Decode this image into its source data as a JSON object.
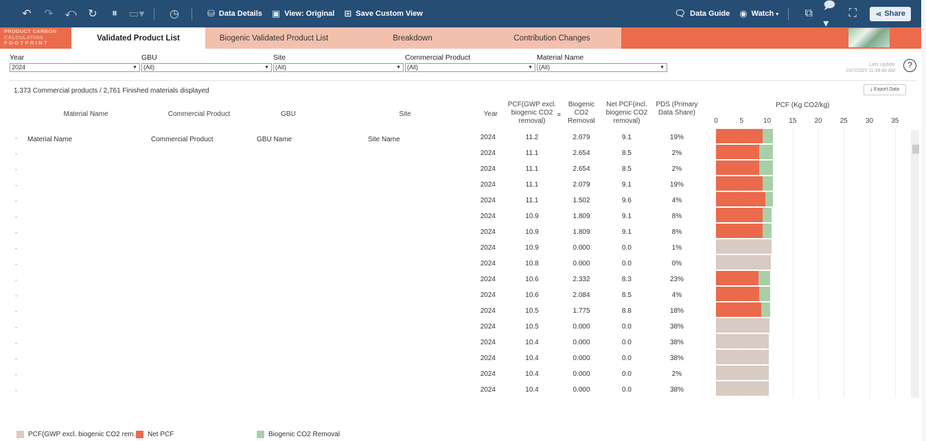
{
  "toolbar": {
    "icons": [
      "undo-icon",
      "redo-icon",
      "revert-icon",
      "refresh-icon",
      "pause-icon",
      "present-icon",
      "history-icon"
    ],
    "data_details": "Data Details",
    "view_original": "View: Original",
    "save_custom_view": "Save Custom View",
    "data_guide": "Data Guide",
    "watch": "Watch",
    "share": "Share"
  },
  "logo": {
    "line1": "PRODUCT CARBON",
    "line2": "CALCULATION",
    "line3": "FOOTPRINT"
  },
  "tabs": [
    {
      "label": "Validated Product List",
      "active": true
    },
    {
      "label": "Biogenic Validated Product List",
      "active": false
    },
    {
      "label": "Breakdown",
      "active": false
    },
    {
      "label": "Contribution Changes",
      "active": false
    }
  ],
  "filters": {
    "year": {
      "label": "Year",
      "value": "2024"
    },
    "gbu": {
      "label": "GBU",
      "value": "(All)"
    },
    "site": {
      "label": "Site",
      "value": "(All)"
    },
    "commercial_product": {
      "label": "Commercial Product",
      "value": "(All)"
    },
    "material_name": {
      "label": "Material Name",
      "value": "(All)"
    }
  },
  "last_update": {
    "label": "Last Update",
    "value": "10/7/2025 11:39:48 AM"
  },
  "summary": "1,373 Commercial products / 2,761 Finished materials displayed",
  "export_label": "Export Data",
  "columns": {
    "material_name": "Material Name",
    "commercial_product": "Commercial Product",
    "gbu": "GBU",
    "site": "Site",
    "year": "Year",
    "pcf": "PCF(GWP excl. biogenic CO2 removal)",
    "biogenic": "Biogenic CO2 Removal",
    "net_pcf": "Net PCF(incl. biogenic CO2 removal)",
    "pds": "PDS (Primary Data Share)",
    "chart": "PCF (Kg CO2/kg)"
  },
  "first_row_text": {
    "material_name": "Material Name",
    "commercial_product": "Commercial Product",
    "gbu": "GBU Name",
    "site": "Site Name"
  },
  "rows": [
    {
      "year": "2024",
      "pcf": "11.2",
      "bio": "2.079",
      "net": "9.1",
      "pds": "19%"
    },
    {
      "year": "2024",
      "pcf": "11.1",
      "bio": "2.654",
      "net": "8.5",
      "pds": "2%"
    },
    {
      "year": "2024",
      "pcf": "11.1",
      "bio": "2.654",
      "net": "8.5",
      "pds": "2%"
    },
    {
      "year": "2024",
      "pcf": "11.1",
      "bio": "2.079",
      "net": "9.1",
      "pds": "19%"
    },
    {
      "year": "2024",
      "pcf": "11.1",
      "bio": "1.502",
      "net": "9.6",
      "pds": "4%"
    },
    {
      "year": "2024",
      "pcf": "10.9",
      "bio": "1.809",
      "net": "9.1",
      "pds": "8%"
    },
    {
      "year": "2024",
      "pcf": "10.9",
      "bio": "1.809",
      "net": "9.1",
      "pds": "8%"
    },
    {
      "year": "2024",
      "pcf": "10.9",
      "bio": "0.000",
      "net": "0.0",
      "pds": "1%"
    },
    {
      "year": "2024",
      "pcf": "10.8",
      "bio": "0.000",
      "net": "0.0",
      "pds": "0%"
    },
    {
      "year": "2024",
      "pcf": "10.6",
      "bio": "2.332",
      "net": "8.3",
      "pds": "23%"
    },
    {
      "year": "2024",
      "pcf": "10.6",
      "bio": "2.084",
      "net": "8.5",
      "pds": "4%"
    },
    {
      "year": "2024",
      "pcf": "10.5",
      "bio": "1.775",
      "net": "8.8",
      "pds": "18%"
    },
    {
      "year": "2024",
      "pcf": "10.5",
      "bio": "0.000",
      "net": "0.0",
      "pds": "38%"
    },
    {
      "year": "2024",
      "pcf": "10.4",
      "bio": "0.000",
      "net": "0.0",
      "pds": "38%"
    },
    {
      "year": "2024",
      "pcf": "10.4",
      "bio": "0.000",
      "net": "0.0",
      "pds": "38%"
    },
    {
      "year": "2024",
      "pcf": "10.4",
      "bio": "0.000",
      "net": "0.0",
      "pds": "2%"
    },
    {
      "year": "2024",
      "pcf": "10.4",
      "bio": "0.000",
      "net": "0.0",
      "pds": "38%"
    }
  ],
  "chart_data": {
    "type": "bar",
    "title": "PCF (Kg CO2/kg)",
    "xlim": [
      0,
      35
    ],
    "x_ticks": [
      "0",
      "5",
      "10",
      "15",
      "20",
      "25",
      "30",
      "35"
    ],
    "series": [
      {
        "name": "PCF(GWP excl. biogenic CO2 rem...",
        "color": "#d7cbc3",
        "values": [
          11.2,
          11.1,
          11.1,
          11.1,
          11.1,
          10.9,
          10.9,
          10.9,
          10.8,
          10.6,
          10.6,
          10.5,
          10.5,
          10.4,
          10.4,
          10.4,
          10.4
        ]
      },
      {
        "name": "Net PCF",
        "color": "#eb6a4c",
        "values": [
          9.1,
          8.5,
          8.5,
          9.1,
          9.6,
          9.1,
          9.1,
          0.0,
          0.0,
          8.3,
          8.5,
          8.8,
          0.0,
          0.0,
          0.0,
          0.0,
          0.0
        ]
      },
      {
        "name": "Biogenic CO2 Removal",
        "color": "#a9cfa9",
        "values": [
          2.079,
          2.654,
          2.654,
          2.079,
          1.502,
          1.809,
          1.809,
          0.0,
          0.0,
          2.332,
          2.084,
          1.775,
          0.0,
          0.0,
          0.0,
          0.0,
          0.0
        ]
      }
    ]
  },
  "legend": [
    {
      "label": "PCF(GWP excl. biogenic CO2 rem...",
      "color": "#d7cbc3"
    },
    {
      "label": "Net PCF",
      "color": "#eb6a4c"
    },
    {
      "label": "Biogenic CO2 Removal",
      "color": "#a9cfa9"
    }
  ]
}
